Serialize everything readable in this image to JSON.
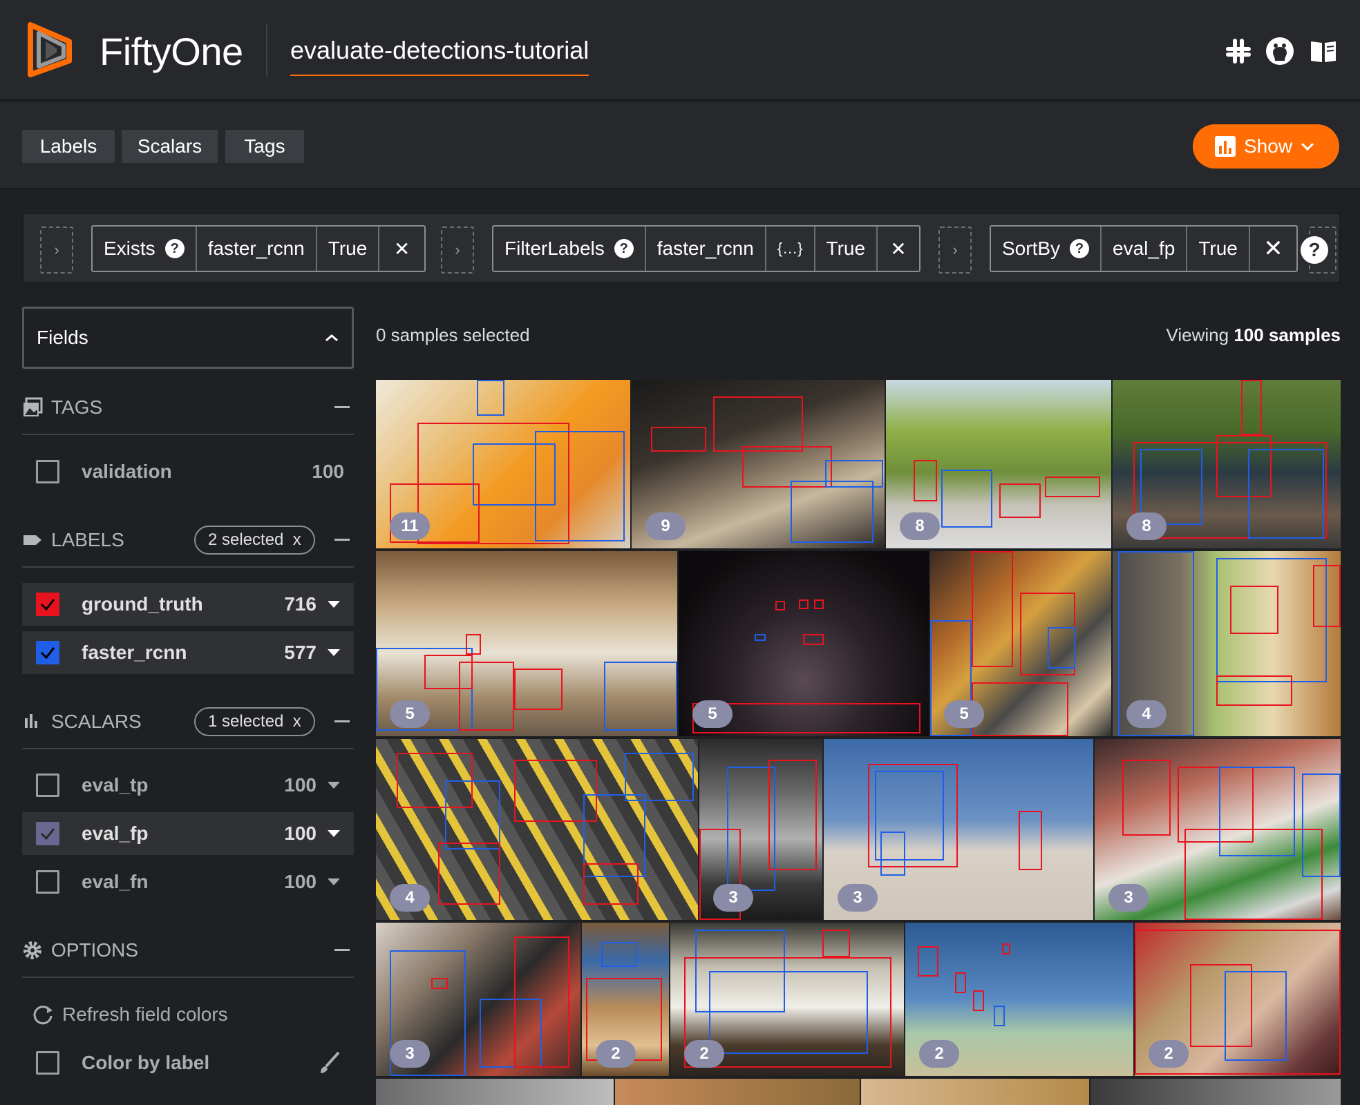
{
  "app": {
    "brand": "FiftyOne",
    "dataset_name": "evaluate-detections-tutorial"
  },
  "header_icons": [
    "slack-icon",
    "github-icon",
    "docs-icon"
  ],
  "tabs": [
    {
      "label": "Labels"
    },
    {
      "label": "Scalars"
    },
    {
      "label": "Tags"
    }
  ],
  "show_button": {
    "label": "Show"
  },
  "view_stages": [
    {
      "name": "Exists",
      "params": [
        "faster_rcnn",
        "True"
      ]
    },
    {
      "name": "FilterLabels",
      "params": [
        "faster_rcnn",
        "{…}",
        "True"
      ]
    },
    {
      "name": "SortBy",
      "params": [
        "eval_fp",
        "True"
      ]
    }
  ],
  "sidebar": {
    "fields_title": "Fields",
    "tags": {
      "title": "TAGS",
      "items": [
        {
          "label": "validation",
          "count": "100"
        }
      ]
    },
    "labels": {
      "title": "LABELS",
      "pill": "2 selected",
      "items": [
        {
          "label": "ground_truth",
          "count": "716",
          "color": "#e8131f"
        },
        {
          "label": "faster_rcnn",
          "count": "577",
          "color": "#1f5fe8"
        }
      ]
    },
    "scalars": {
      "title": "SCALARS",
      "pill": "1 selected",
      "items": [
        {
          "label": "eval_tp",
          "count": "100",
          "checked": false
        },
        {
          "label": "eval_fp",
          "count": "100",
          "checked": true
        },
        {
          "label": "eval_fn",
          "count": "100",
          "checked": false
        }
      ]
    },
    "options": {
      "title": "OPTIONS",
      "refresh_label": "Refresh field colors",
      "color_by_label": "Color by label"
    }
  },
  "main": {
    "samples_selected": "0 samples selected",
    "viewing_prefix": "Viewing",
    "viewing_count": "100 samples"
  },
  "tiles": [
    {
      "badge": "11"
    },
    {
      "badge": "9"
    },
    {
      "badge": "8"
    },
    {
      "badge": "8"
    },
    {
      "badge": "5"
    },
    {
      "badge": "5"
    },
    {
      "badge": "5"
    },
    {
      "badge": "4"
    },
    {
      "badge": "4"
    },
    {
      "badge": "3"
    },
    {
      "badge": "3"
    },
    {
      "badge": "3"
    },
    {
      "badge": "3"
    },
    {
      "badge": "2"
    },
    {
      "badge": "2"
    },
    {
      "badge": "2"
    },
    {
      "badge": "2"
    }
  ],
  "colors": {
    "accent": "#ff6d04",
    "ground_truth": "#e8131f",
    "predictions": "#1f5fe8",
    "badge": "#8a8ba6"
  }
}
